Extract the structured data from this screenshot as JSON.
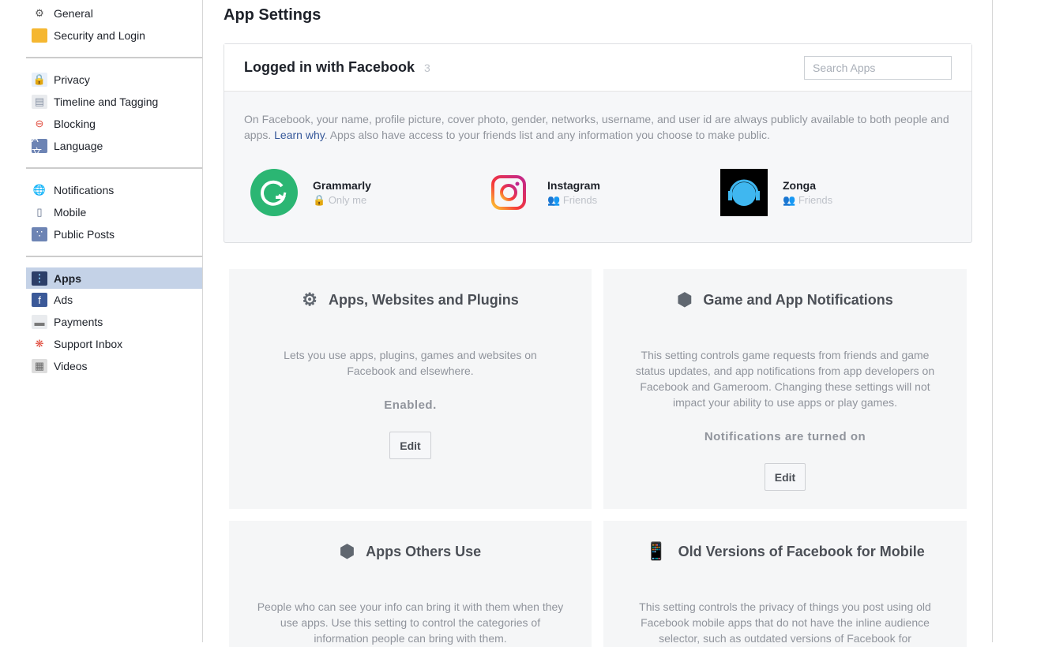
{
  "sidebar": {
    "groups": [
      [
        {
          "label": "General",
          "icon": "gears-icon"
        },
        {
          "label": "Security and Login",
          "icon": "badge-icon"
        }
      ],
      [
        {
          "label": "Privacy",
          "icon": "lock-icon"
        },
        {
          "label": "Timeline and Tagging",
          "icon": "timeline-icon"
        },
        {
          "label": "Blocking",
          "icon": "block-icon"
        },
        {
          "label": "Language",
          "icon": "language-icon"
        }
      ],
      [
        {
          "label": "Notifications",
          "icon": "globe-icon"
        },
        {
          "label": "Mobile",
          "icon": "mobile-icon"
        },
        {
          "label": "Public Posts",
          "icon": "rss-icon"
        }
      ],
      [
        {
          "label": "Apps",
          "icon": "apps-icon",
          "active": true
        },
        {
          "label": "Ads",
          "icon": "ads-icon"
        },
        {
          "label": "Payments",
          "icon": "credit-card-icon"
        },
        {
          "label": "Support Inbox",
          "icon": "lifebuoy-icon"
        },
        {
          "label": "Videos",
          "icon": "film-icon"
        }
      ]
    ]
  },
  "page": {
    "title": "App Settings"
  },
  "panel": {
    "title": "Logged in with Facebook",
    "count": "3",
    "search_placeholder": "Search Apps",
    "desc_1": "On Facebook, your name, profile picture, cover photo, gender, networks, username, and user id are always publicly available to both people and apps. ",
    "link": "Learn why",
    "desc_2": ". Apps also have access to your friends list and any information you choose to make public.",
    "apps": [
      {
        "name": "Grammarly",
        "privacy": "Only me",
        "privacy_icon": "lock-icon"
      },
      {
        "name": "Instagram",
        "privacy": "Friends",
        "privacy_icon": "friends-icon"
      },
      {
        "name": "Zonga",
        "privacy": "Friends",
        "privacy_icon": "friends-icon"
      }
    ]
  },
  "cards": [
    {
      "title": "Apps, Websites and Plugins",
      "icon": "gear-icon",
      "desc": "Lets you use apps, plugins, games and websites on Facebook and elsewhere.",
      "status": "Enabled.",
      "button": "Edit"
    },
    {
      "title": "Game and App Notifications",
      "icon": "cube-icon",
      "desc": "This setting controls game requests from friends and game status updates, and app notifications from app developers on Facebook and Gameroom. Changing these settings will not impact your ability to use apps or play games.",
      "status": "Notifications are turned on",
      "button": "Edit"
    },
    {
      "title": "Apps Others Use",
      "icon": "cube-icon",
      "desc": "People who can see your info can bring it with them when they use apps. Use this setting to control the categories of information people can bring with them."
    },
    {
      "title": "Old Versions of Facebook for Mobile",
      "icon": "mobile-icon",
      "desc": "This setting controls the privacy of things you post using old Facebook mobile apps that do not have the inline audience selector, such as outdated versions of Facebook for BlackBerry."
    }
  ]
}
